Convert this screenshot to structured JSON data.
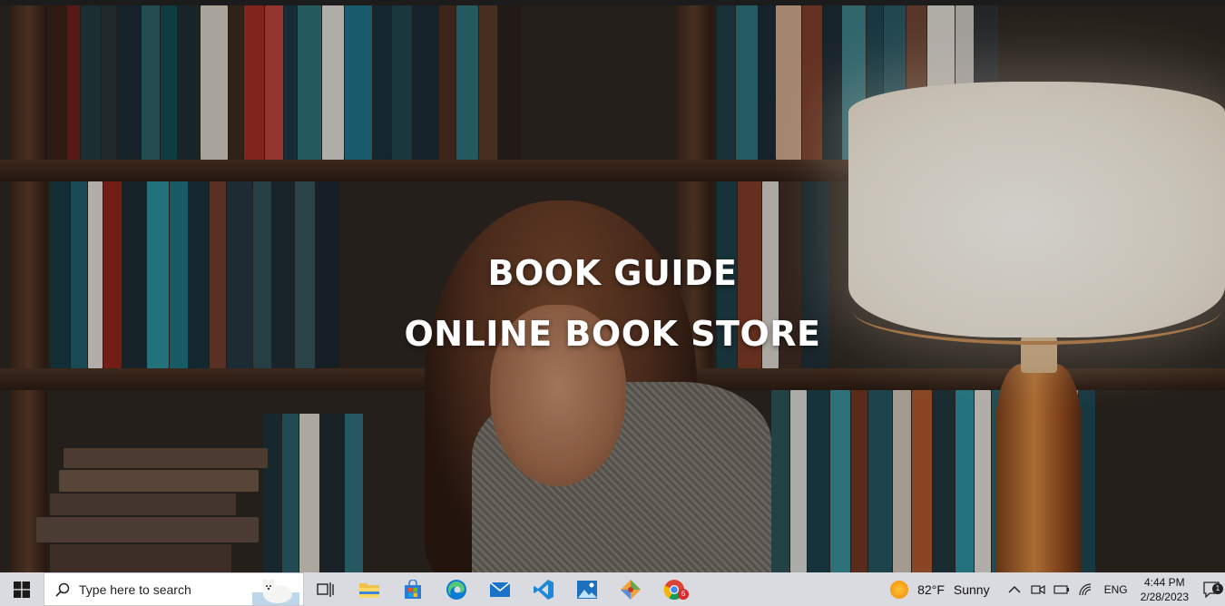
{
  "hero": {
    "title_line1": "BOOK GUIDE",
    "title_line2": "ONLINE BOOK STORE"
  },
  "taskbar": {
    "search_placeholder": "Type here to search",
    "pinned": [
      "task-view-icon",
      "file-explorer-icon",
      "microsoft-store-icon",
      "edge-icon",
      "mail-icon",
      "vscode-icon",
      "photos-icon",
      "git-icon",
      "chrome-icon"
    ],
    "weather": {
      "temp": "82°F",
      "condition": "Sunny"
    },
    "language": "ENG",
    "time": "4:44 PM",
    "date": "2/28/2023",
    "notification_count": "1",
    "chrome_badge": "6"
  },
  "colors": {
    "taskbar_bg": "#d9dbe0",
    "hero_text": "#ffffff",
    "accent_blue": "#0078d4"
  }
}
